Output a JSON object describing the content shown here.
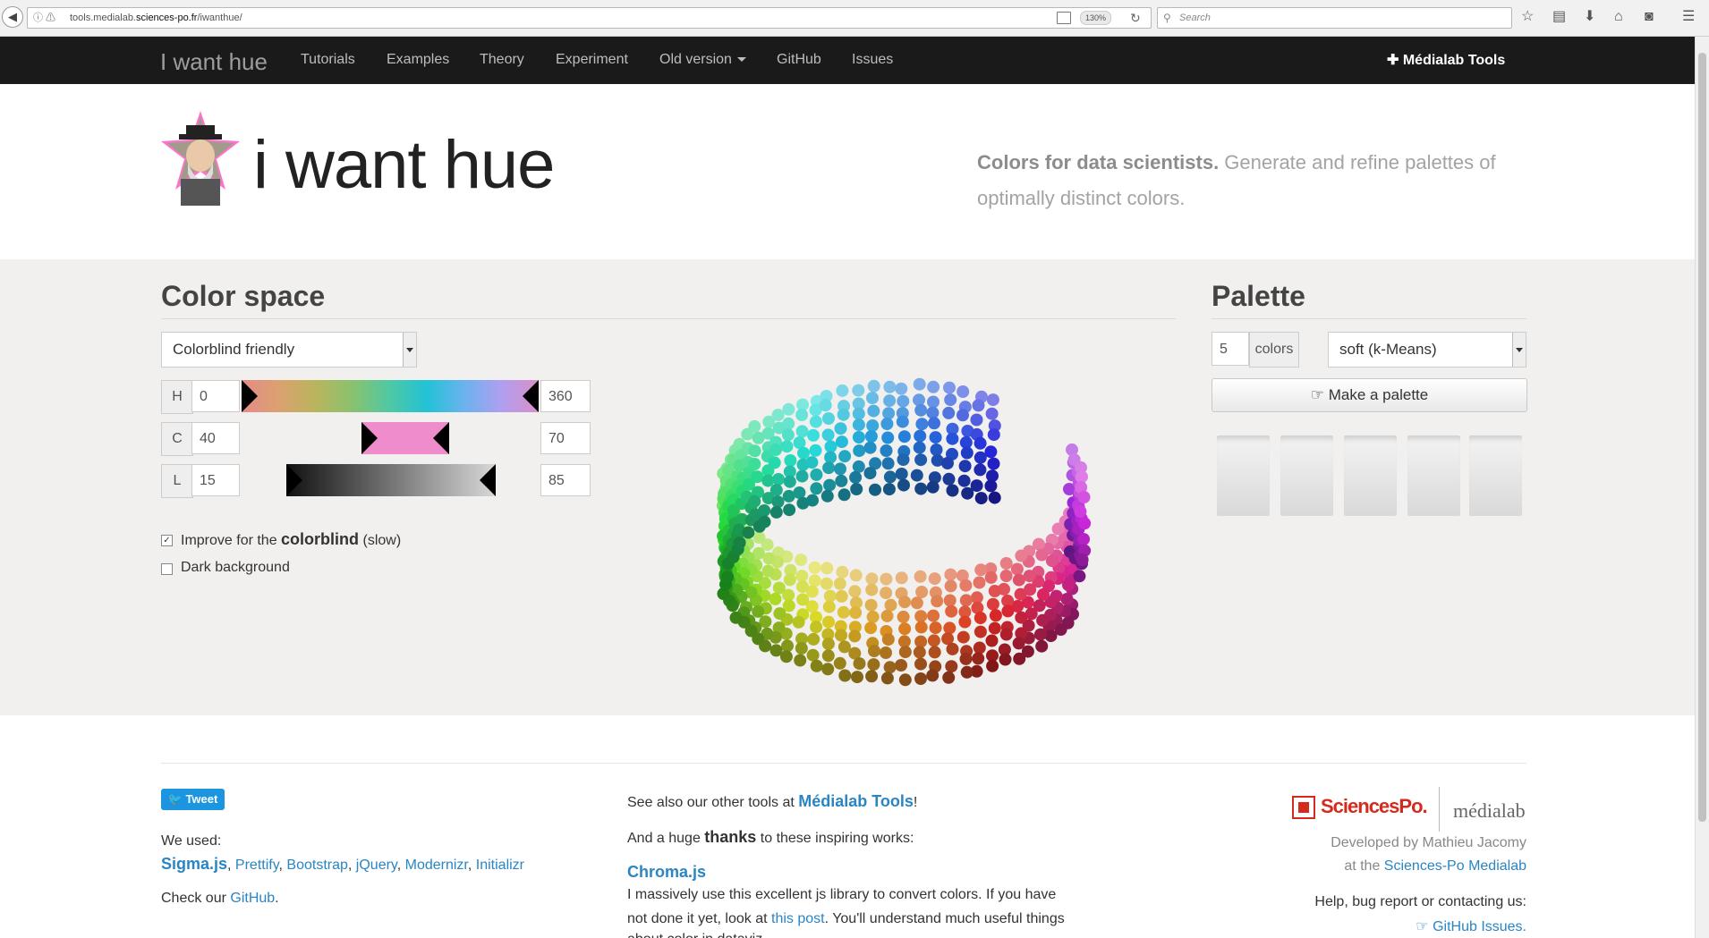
{
  "browser": {
    "url_prefix": "ⓘ ⚠",
    "url_host_pre": "tools.medialab.",
    "url_host_main": "sciences-po.fr",
    "url_path": "/iwanthue/",
    "zoom": "130%",
    "search_placeholder": "Search"
  },
  "nav": {
    "brand": "I want hue",
    "items": [
      "Tutorials",
      "Examples",
      "Theory",
      "Experiment",
      "Old version",
      "GitHub",
      "Issues"
    ],
    "right": "✚ Médialab Tools"
  },
  "header": {
    "title": "i want hue",
    "tagline_bold": "Colors for data scientists.",
    "tagline_rest": " Generate and refine palettes of optimally distinct colors."
  },
  "color_space": {
    "title": "Color space",
    "preset": "Colorblind friendly",
    "h": {
      "label": "H",
      "min": "0",
      "max": "360"
    },
    "c": {
      "label": "C",
      "min": "40",
      "max": "70"
    },
    "l": {
      "label": "L",
      "min": "15",
      "max": "85"
    },
    "colorblind_pre": "Improve for the ",
    "colorblind_bold": "colorblind",
    "colorblind_post": " (slow)",
    "colorblind_checked": "✓",
    "dark_background": "Dark background"
  },
  "palette": {
    "title": "Palette",
    "count": "5",
    "count_unit": "colors",
    "mode": "soft (k-Means)",
    "button": "☞ Make a palette",
    "swatches": 5
  },
  "footer": {
    "tweet": "Tweet",
    "we_used": "We used:",
    "libs_main": "Sigma.js",
    "libs": [
      "Prettify",
      "Bootstrap",
      "jQuery",
      "Modernizr",
      "Initializr"
    ],
    "check_pre": "Check our ",
    "check_link": "GitHub",
    "see_also_pre": "See also our other tools at ",
    "see_also_link": "Médialab Tools",
    "see_also_post": "!",
    "thanks_pre": "And a huge ",
    "thanks_bold": "thanks",
    "thanks_post": " to these inspiring works:",
    "chroma": "Chroma.js",
    "chroma_text1": "I massively use this excellent js library to convert colors. If you have",
    "chroma_text2_pre": "not done it yet, look at ",
    "chroma_text2_link": "this post",
    "chroma_text2_post": ". You'll understand much useful things",
    "chroma_text3": "about color in dataviz.",
    "sciencespo": "SciencesPo.",
    "medialab": "médialab",
    "dev_by": "Developed by Mathieu Jacomy",
    "at_pre": "at the ",
    "at_link": "Sciences-Po Medialab",
    "help": "Help, bug report or contacting us:",
    "issues_link": "☞ GitHub Issues."
  }
}
